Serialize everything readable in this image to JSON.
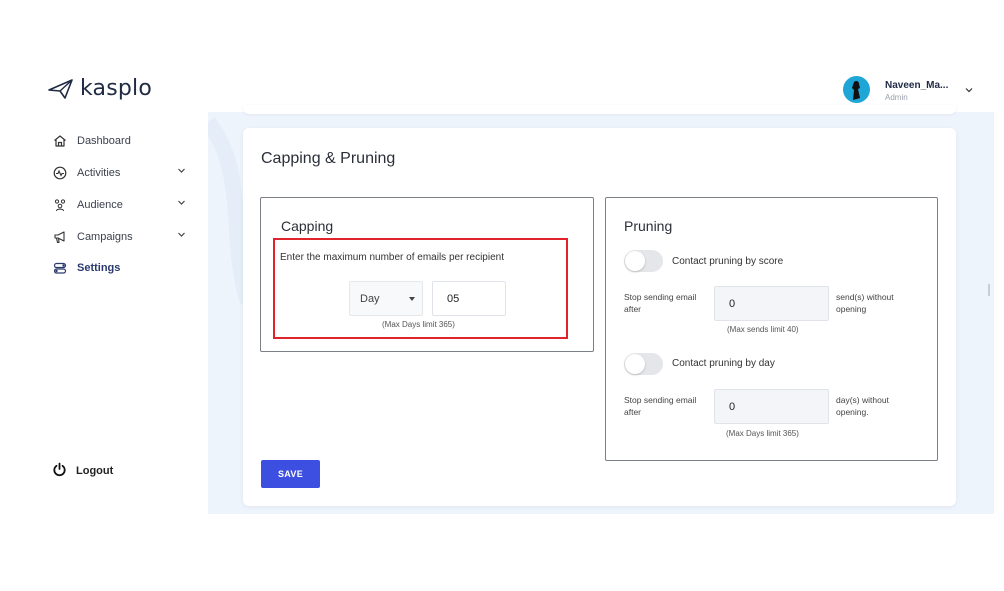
{
  "brand": {
    "name": "kasplo"
  },
  "sidebar": {
    "items": [
      {
        "label": "Dashboard",
        "icon": "home-icon",
        "has_chevron": false
      },
      {
        "label": "Activities",
        "icon": "activity-icon",
        "has_chevron": true
      },
      {
        "label": "Audience",
        "icon": "audience-icon",
        "has_chevron": true
      },
      {
        "label": "Campaigns",
        "icon": "megaphone-icon",
        "has_chevron": true
      },
      {
        "label": "Settings",
        "icon": "settings-toggle-icon",
        "has_chevron": false,
        "active": true
      }
    ],
    "logout_label": "Logout"
  },
  "header": {
    "user_name": "Naveen_Ma...",
    "user_role": "Admin"
  },
  "page": {
    "title": "Capping & Pruning",
    "save_label": "SAVE"
  },
  "capping": {
    "title": "Capping",
    "description": "Enter the maximum number of emails per recipient",
    "period_select": "Day",
    "value": "05",
    "hint": "(Max Days limit 365)"
  },
  "pruning": {
    "title": "Pruning",
    "by_score": {
      "toggle_label": "Contact pruning by score",
      "enabled": false,
      "prefix_label": "Stop sending email after",
      "value": "0",
      "suffix_label": "send(s) without opening",
      "hint": "(Max sends limit 40)"
    },
    "by_day": {
      "toggle_label": "Contact pruning by day",
      "enabled": false,
      "prefix_label": "Stop sending email after",
      "value": "0",
      "suffix_label": "day(s) without opening.",
      "hint": "(Max Days limit 365)"
    }
  },
  "colors": {
    "accent": "#3c4fe0",
    "highlight_border": "#e0242b",
    "main_background": "#eef4fb"
  }
}
